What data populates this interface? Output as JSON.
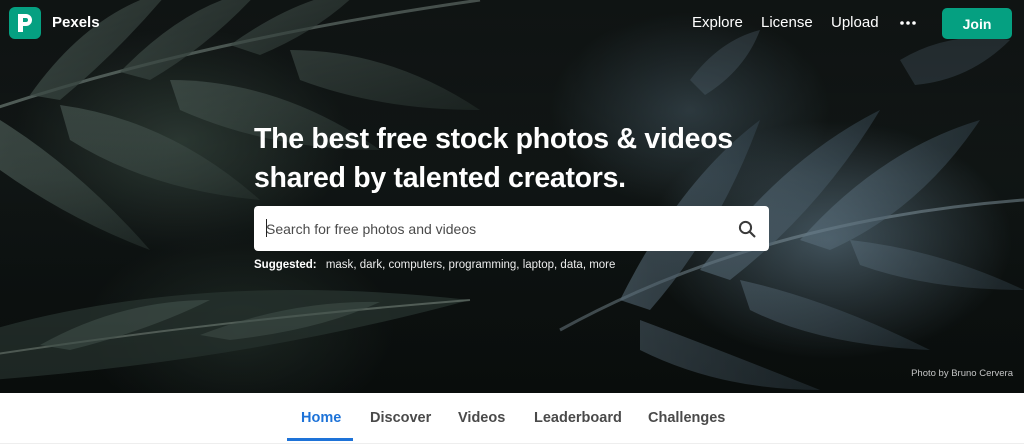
{
  "header": {
    "brand": "Pexels",
    "nav": {
      "explore": "Explore",
      "license": "License",
      "upload": "Upload"
    },
    "more_icon": "more-horizontal-icon",
    "join_label": "Join"
  },
  "hero": {
    "headline_line1": "The best free stock photos & videos",
    "headline_line2": "shared by talented creators.",
    "search": {
      "placeholder": "Search for free photos and videos",
      "icon": "search-icon"
    },
    "suggested": {
      "label": "Suggested:",
      "tags": [
        "mask",
        "dark",
        "computers",
        "programming",
        "laptop",
        "data",
        "more"
      ]
    },
    "photo_credit": "Photo by Bruno Cervera"
  },
  "tabs": [
    {
      "label": "Home",
      "active": true
    },
    {
      "label": "Discover",
      "active": false
    },
    {
      "label": "Videos",
      "active": false
    },
    {
      "label": "Leaderboard",
      "active": false
    },
    {
      "label": "Challenges",
      "active": false
    }
  ],
  "colors": {
    "brand": "#05a081",
    "active_tab": "#1e73d8",
    "tab_text": "#4a4a4a"
  }
}
